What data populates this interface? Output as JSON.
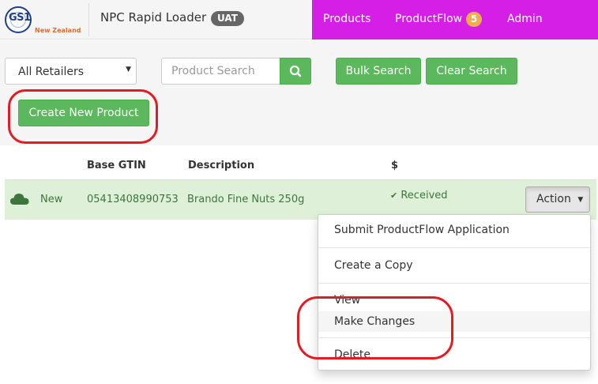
{
  "header": {
    "logo_text": "GS1",
    "logo_sub": "New Zealand",
    "app_title": "NPC Rapid Loader",
    "env_badge": "UAT",
    "nav": {
      "products": "Products",
      "productflow": "ProductFlow",
      "productflow_count": "5",
      "admin": "Admin"
    }
  },
  "toolbar": {
    "retailer_select": "All Retailers",
    "search_placeholder": "Product Search",
    "bulk_search": "Bulk Search",
    "clear_search": "Clear Search",
    "create_product": "Create New Product"
  },
  "table": {
    "headers": {
      "gtin": "Base GTIN",
      "description": "Description",
      "price": "$"
    },
    "rows": [
      {
        "status": "New",
        "gtin": "05413408990753",
        "description": "Brando Fine Nuts 250g",
        "state": "Received",
        "action": "Action"
      }
    ]
  },
  "action_menu": {
    "items": [
      "Submit ProductFlow Application",
      "Create a Copy",
      "View",
      "Make Changes",
      "Delete"
    ],
    "highlighted": "Make Changes"
  },
  "colors": {
    "nav_bg": "#d61fe6",
    "primary_green": "#5cb85c",
    "row_success": "#dff0d8",
    "annotation_red": "#e31b23",
    "badge_orange": "#f0ad4e"
  }
}
